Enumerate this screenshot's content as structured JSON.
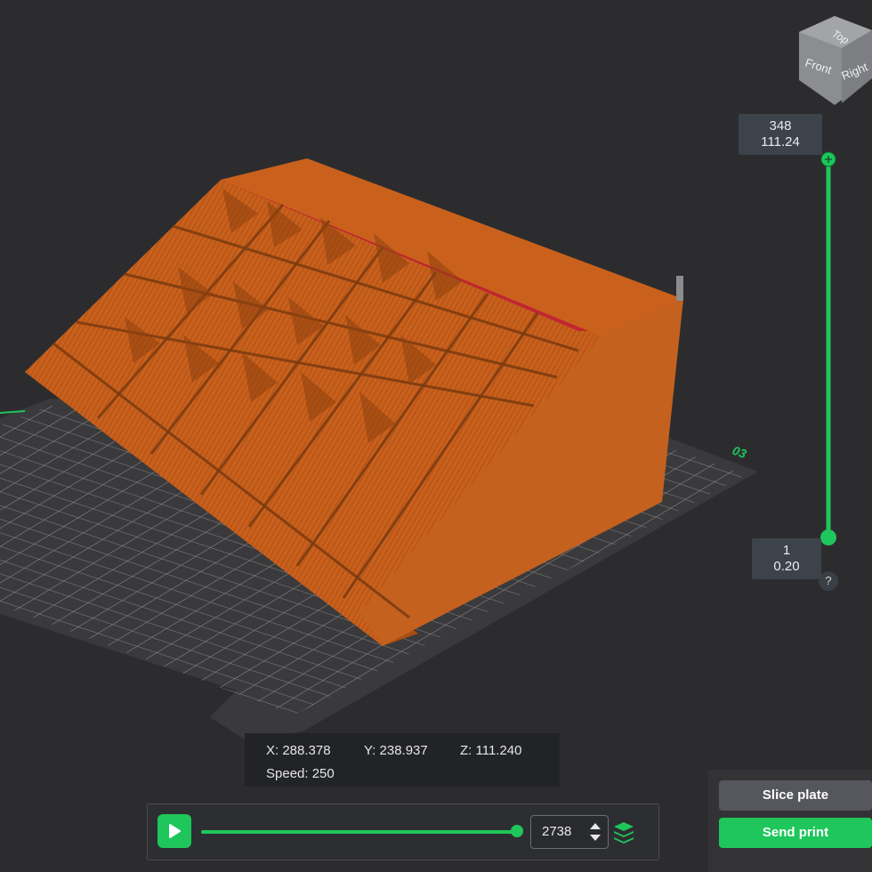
{
  "view_cube": {
    "top": "Top",
    "front": "Front",
    "right": "Right"
  },
  "plate": {
    "label": "03"
  },
  "layer_slider": {
    "top_layer": "348",
    "top_height": "111.24",
    "bottom_layer": "1",
    "bottom_height": "0.20",
    "help": "?"
  },
  "coords": {
    "x": "X: 288.378",
    "y": "Y: 238.937",
    "z": "Z: 111.240",
    "speed": "Speed: 250"
  },
  "playback": {
    "move_value": "2738",
    "progress": 1.0
  },
  "actions": {
    "slice": "Slice plate",
    "send": "Send print"
  },
  "colors": {
    "accent": "#1ec65b",
    "model": "#c9611c",
    "model_dark": "#a84e15",
    "model_red": "#c02631",
    "bed": "#3a3a3c"
  }
}
